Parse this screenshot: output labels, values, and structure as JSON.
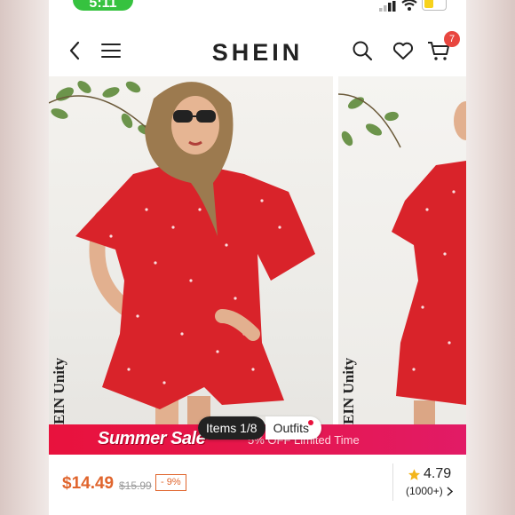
{
  "status_bar": {
    "time": "5:11"
  },
  "header": {
    "brand": "SHEIN",
    "cart_count": "7",
    "icons": [
      "back-arrow-icon",
      "menu-icon",
      "search-icon",
      "heart-icon",
      "cart-icon"
    ]
  },
  "gallery": {
    "brand_watermark_main": "EIN Unity",
    "brand_watermark_side": "EIN Unity",
    "tabs": [
      {
        "label": "Items 1/8",
        "active": true
      },
      {
        "label": "Outfits",
        "active": false
      }
    ]
  },
  "banner": {
    "title": "Summer Sale",
    "subtitle": "5% OFF Limited Time"
  },
  "product": {
    "price": "$14.49",
    "original_price": "$15.99",
    "discount": "- 9%",
    "rating": "4.79",
    "reviews": "(1000+)"
  },
  "colors": {
    "accent_red": "#e8123d",
    "price_orange": "#e0652d",
    "dress_red": "#d9232a",
    "status_green": "#36c23f"
  }
}
